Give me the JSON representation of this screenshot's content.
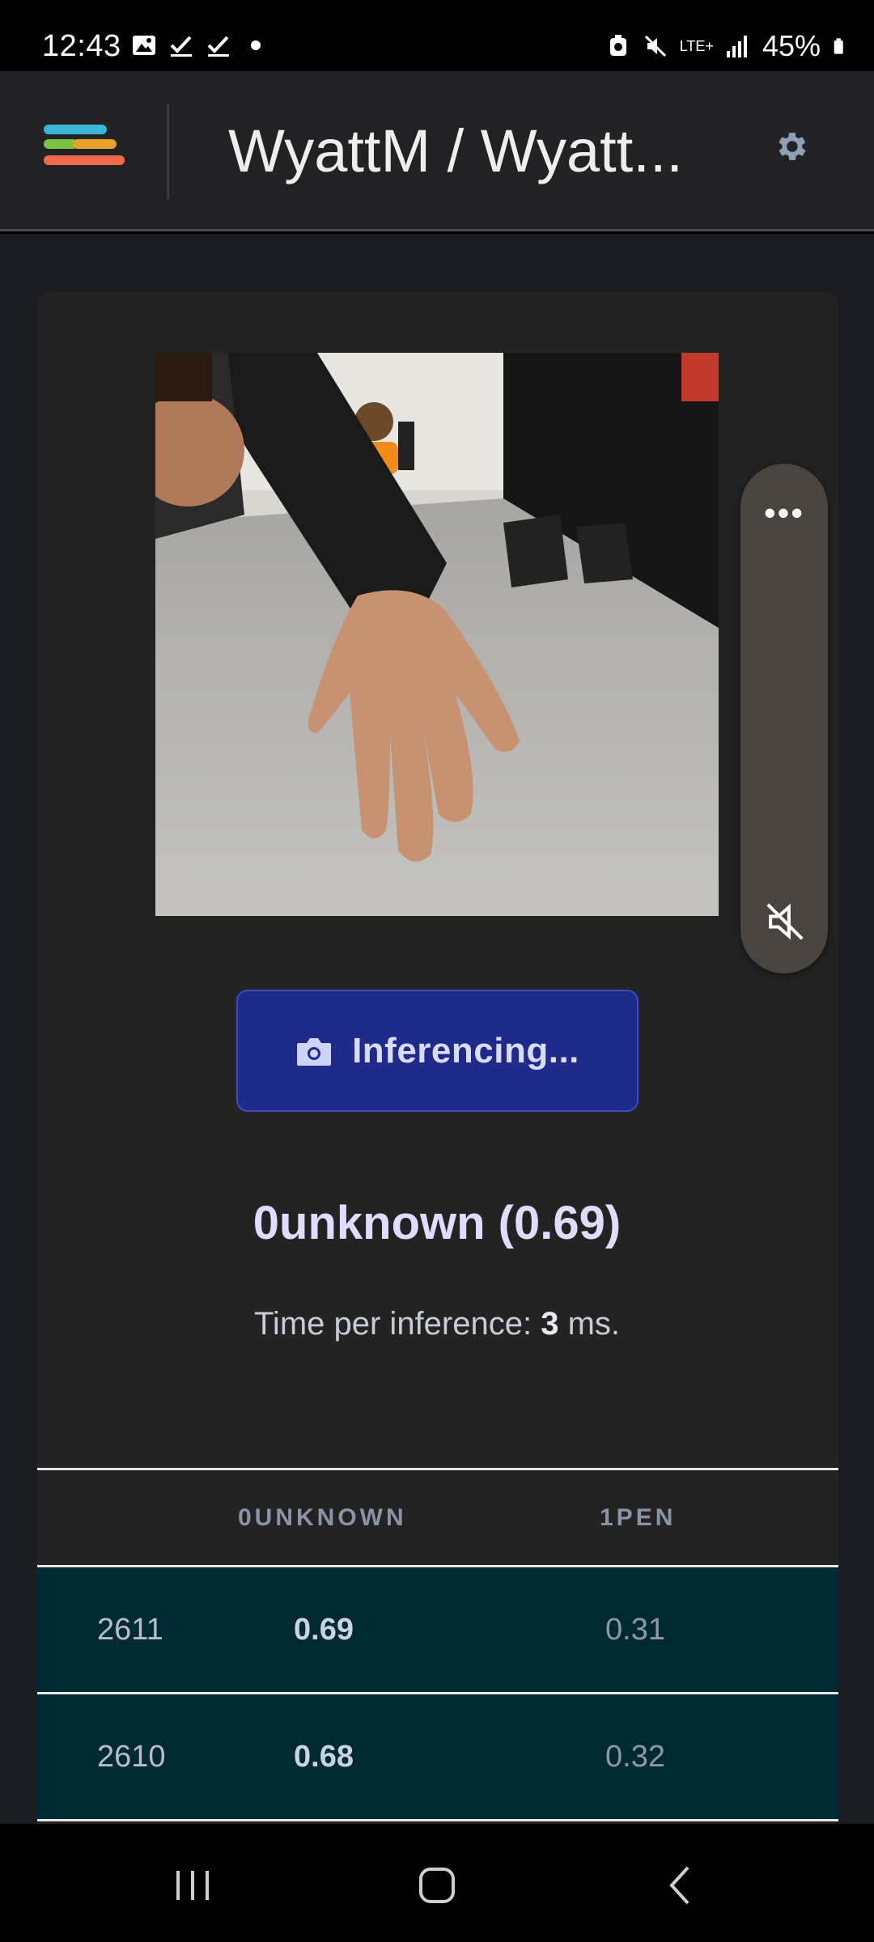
{
  "status_bar": {
    "time": "12:43",
    "battery": "45%",
    "network": "LTE+"
  },
  "header": {
    "title": "WyattM / Wyatt...",
    "logo_colors": [
      "#3bb6d9",
      "#7cc242",
      "#e8a22b",
      "#ef6a4b"
    ]
  },
  "camera": {
    "description_icon": "camera-feed"
  },
  "side_panel": {
    "more_label": "•••"
  },
  "inference_button": {
    "label": "Inferencing..."
  },
  "result": {
    "label": "0unknown (0.69)"
  },
  "timing": {
    "prefix": "Time per inference: ",
    "value": "3",
    "suffix": " ms."
  },
  "table": {
    "columns": [
      "",
      "0UNKNOWN",
      "1PEN"
    ],
    "rows": [
      {
        "id": "2611",
        "unknown": "0.69",
        "pen": "0.31"
      },
      {
        "id": "2610",
        "unknown": "0.68",
        "pen": "0.32"
      }
    ]
  }
}
